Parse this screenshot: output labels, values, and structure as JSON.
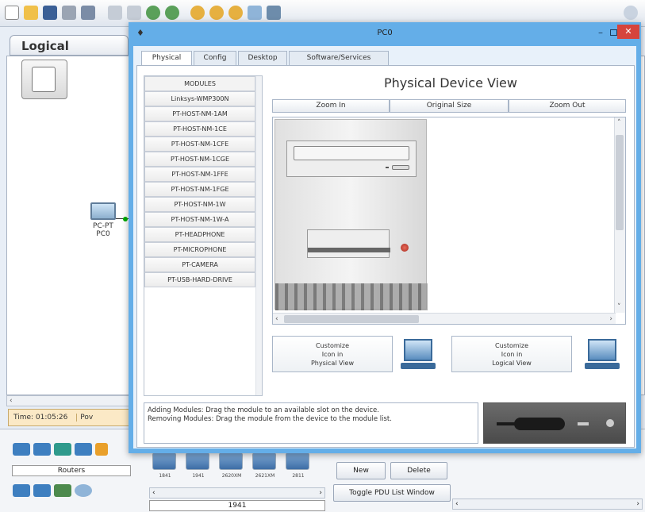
{
  "workspace": {
    "tab_label": "Logical",
    "node_type": "PC-PT",
    "node_name": "PC0",
    "time_label": "Time: 01:05:26",
    "time_tail": "Pov"
  },
  "bottom": {
    "category_label": "Routers",
    "models": [
      "1841",
      "1941",
      "2620XM",
      "2621XM",
      "2811"
    ],
    "selected_model": "1941",
    "new_label": "New",
    "delete_label": "Delete",
    "toggle_pdu_label": "Toggle PDU List Window"
  },
  "dialog": {
    "title": "PC0",
    "tabs": [
      "Physical",
      "Config",
      "Desktop",
      "Software/Services"
    ],
    "active_tab": "Physical",
    "modules_header": "MODULES",
    "modules": [
      "Linksys-WMP300N",
      "PT-HOST-NM-1AM",
      "PT-HOST-NM-1CE",
      "PT-HOST-NM-1CFE",
      "PT-HOST-NM-1CGE",
      "PT-HOST-NM-1FFE",
      "PT-HOST-NM-1FGE",
      "PT-HOST-NM-1W",
      "PT-HOST-NM-1W-A",
      "PT-HEADPHONE",
      "PT-MICROPHONE",
      "PT-CAMERA",
      "PT-USB-HARD-DRIVE"
    ],
    "view_title": "Physical Device View",
    "zoom_in": "Zoom In",
    "original_size": "Original Size",
    "zoom_out": "Zoom Out",
    "customize_physical": [
      "Customize",
      "Icon in",
      "Physical View"
    ],
    "customize_logical": [
      "Customize",
      "Icon in",
      "Logical View"
    ],
    "help_lines": [
      "Adding Modules: Drag the module to an available slot on the device.",
      "Removing Modules: Drag the module from the device to the module list."
    ]
  },
  "colors": {
    "dialog_frame": "#64aee8",
    "close_button": "#d6443c",
    "link_status": "#00aa00"
  }
}
